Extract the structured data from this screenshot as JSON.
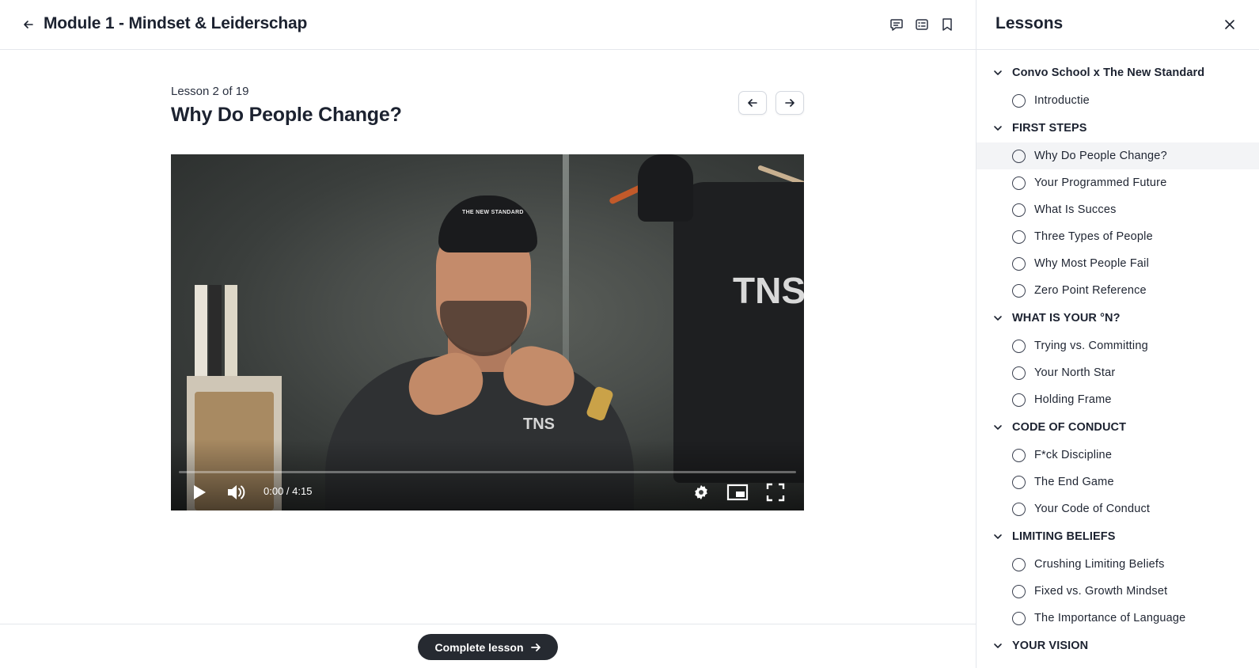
{
  "header": {
    "module_title": "Module 1 - Mindset & Leiderschap"
  },
  "lesson": {
    "counter": "Lesson 2 of 19",
    "title": "Why Do People Change?"
  },
  "video": {
    "time_display": "0:00 / 4:15",
    "progress": 0,
    "cap_text": "THE NEW STANDARD",
    "shirt_text": "TNS",
    "chest_text": "TNS"
  },
  "footer": {
    "complete_label": "Complete lesson"
  },
  "sidebar": {
    "title": "Lessons",
    "sections": [
      {
        "label": "Convo School x The New Standard",
        "lessons": [
          {
            "label": "Introductie"
          }
        ]
      },
      {
        "label": "FIRST STEPS",
        "lessons": [
          {
            "label": "Why Do People Change?",
            "active": true
          },
          {
            "label": "Your Programmed Future"
          },
          {
            "label": "What Is Succes"
          },
          {
            "label": "Three Types of People"
          },
          {
            "label": "Why Most People Fail"
          },
          {
            "label": "Zero Point Reference"
          }
        ]
      },
      {
        "label": "WHAT IS YOUR °N?",
        "lessons": [
          {
            "label": "Trying vs. Committing"
          },
          {
            "label": "Your North Star"
          },
          {
            "label": "Holding Frame"
          }
        ]
      },
      {
        "label": "CODE OF CONDUCT",
        "lessons": [
          {
            "label": "F*ck Discipline"
          },
          {
            "label": "The End Game"
          },
          {
            "label": "Your Code of Conduct"
          }
        ]
      },
      {
        "label": "LIMITING BELIEFS",
        "lessons": [
          {
            "label": "Crushing Limiting Beliefs"
          },
          {
            "label": "Fixed vs. Growth Mindset"
          },
          {
            "label": "The Importance of Language"
          }
        ]
      },
      {
        "label": "YOUR VISION",
        "lessons": []
      }
    ]
  },
  "colors": {
    "text_primary": "#1c2230",
    "border": "#e4e7ec",
    "button_dark": "#262a31",
    "active_row": "#f3f4f6"
  },
  "icons": {
    "back": "arrow-left-icon",
    "comments": "comment-icon",
    "notes": "notes-icon",
    "bookmark": "bookmark-icon",
    "close": "close-icon",
    "prev": "arrow-left-icon",
    "next": "arrow-right-icon",
    "play": "play-icon",
    "volume": "volume-icon",
    "settings": "gear-icon",
    "pip": "picture-in-picture-icon",
    "fullscreen": "fullscreen-icon",
    "section": "chevron-down-icon",
    "lesson_status": "circle-icon"
  }
}
